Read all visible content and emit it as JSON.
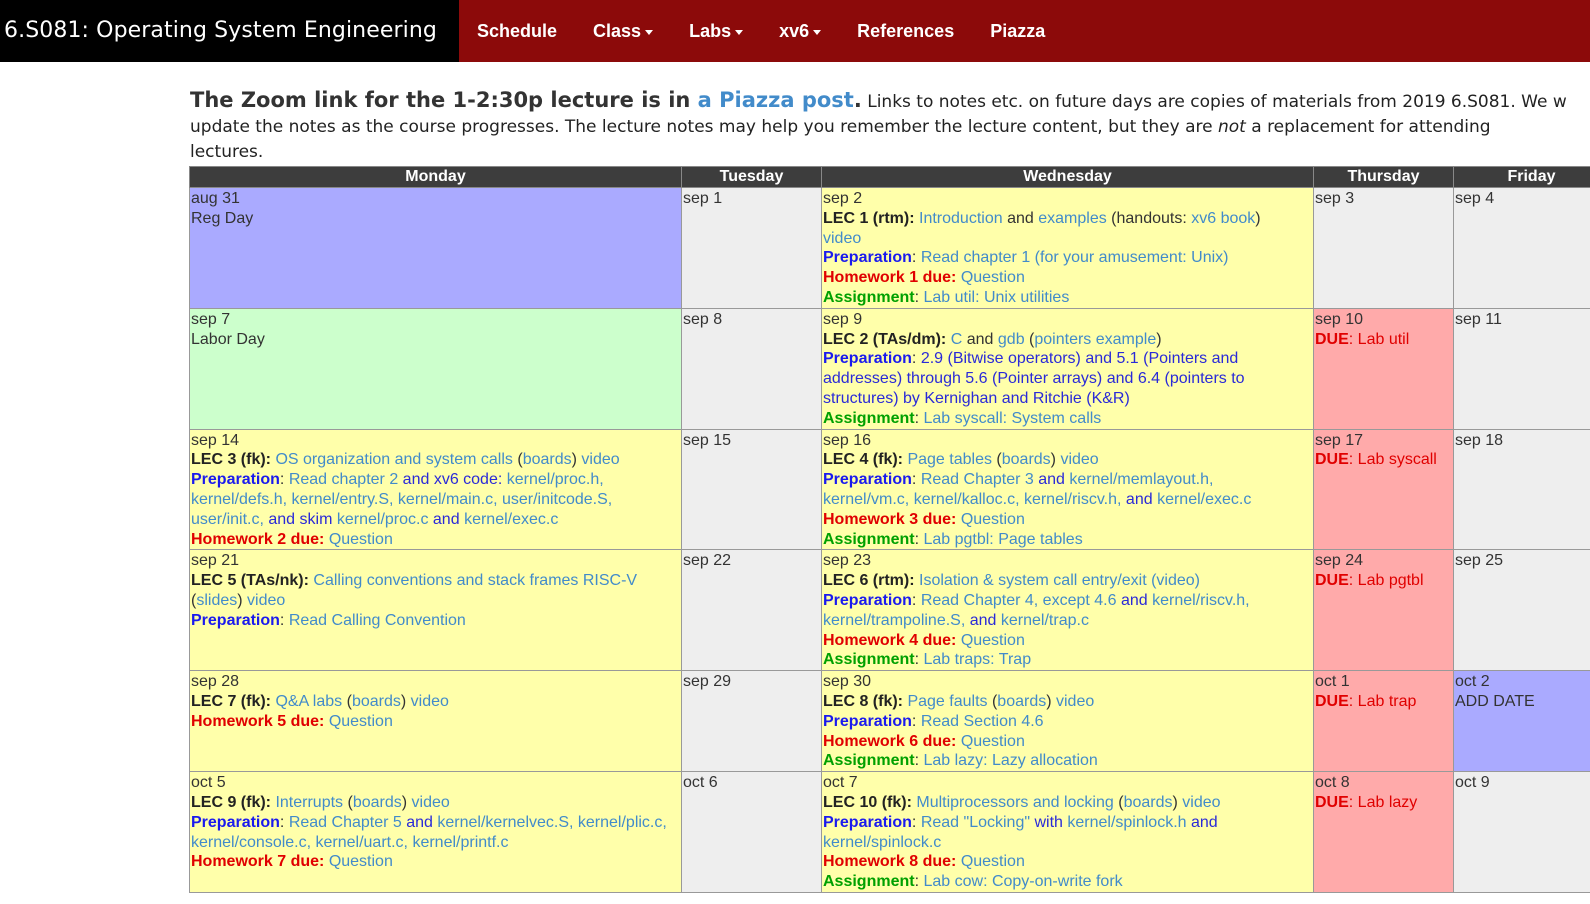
{
  "navbar": {
    "brand": "6.S081: Operating System Engineering",
    "items": [
      "Schedule",
      "Class",
      "Labs",
      "xv6",
      "References",
      "Piazza"
    ]
  },
  "intro": {
    "lead_prefix": "The Zoom link for the 1-2:30p lecture is in ",
    "lead_link": "a Piazza post",
    "lead_suffix": ".",
    "line1_rest": " Links to notes etc. on future days are copies of materials from 2019 6.S081. We w",
    "line2": "update the notes as the course progresses. The lecture notes may help you remember the lecture content, but they are ",
    "line2_em": "not",
    "line2_end": " a replacement for attending",
    "line3": "lectures."
  },
  "calendar": {
    "headers": [
      "Monday",
      "Tuesday",
      "Wednesday",
      "Thursday",
      "Friday"
    ],
    "rows": [
      {
        "mon": {
          "date": "aug 31",
          "note": "Reg Day"
        },
        "tue": {
          "date": "sep 1"
        },
        "wed": {
          "date": "sep 2",
          "lec": "LEC 1 (rtm):",
          "topic": "Introduction",
          "and": "and",
          "topic2": "examples",
          "handouts_pre": "(handouts:",
          "handouts_link": "xv6 book",
          "handouts_post": ")",
          "video": "video",
          "prep_label": "Preparation",
          "prep_text": "Read chapter 1 (for your amusement: Unix)",
          "hw_label": "Homework 1 due:",
          "hw_link": "Question",
          "asg_label": "Assignment",
          "asg_link": "Lab util: Unix utilities"
        },
        "thu": {
          "date": "sep 3"
        },
        "fri": {
          "date": "sep 4"
        }
      },
      {
        "mon": {
          "date": "sep 7",
          "note": "Labor Day"
        },
        "tue": {
          "date": "sep 8"
        },
        "wed": {
          "date": "sep 9",
          "lec": "LEC 2 (TAs/dm):",
          "topic": "C",
          "and": "and",
          "topic2": "gdb",
          "extra_pre": "(",
          "extra_link": "pointers example",
          "extra_post": ")",
          "prep_label": "Preparation",
          "prep_line1": "2.9 (Bitwise operators) and 5.1 (Pointers and",
          "prep_line2": "addresses) through 5.6 (Pointer arrays) and 6.4 (pointers to",
          "prep_line3": "structures) by Kernighan and Ritchie (K&R)",
          "asg_label": "Assignment",
          "asg_link": "Lab syscall: System calls"
        },
        "thu": {
          "date": "sep 10",
          "due_label": "DUE",
          "due_text": "Lab util"
        },
        "fri": {
          "date": "sep 11"
        }
      },
      {
        "mon": {
          "date": "sep 14",
          "lec": "LEC 3 (fk):",
          "topic": "OS organization and system calls",
          "boards": "boards",
          "video": "video",
          "prep_label": "Preparation",
          "prep_line1_a": "Read chapter 2",
          "prep_line1_b": "and xv6 code:",
          "prep_line1_c": "kernel/proc.h,",
          "prep_line2": "kernel/defs.h, kernel/entry.S, kernel/main.c, user/initcode.S,",
          "prep_line3_a": "user/init.c,",
          "prep_line3_b": "and skim",
          "prep_line3_c": "kernel/proc.c",
          "prep_line3_d": "and",
          "prep_line3_e": "kernel/exec.c",
          "hw_label": "Homework 2 due:",
          "hw_link": "Question"
        },
        "tue": {
          "date": "sep 15"
        },
        "wed": {
          "date": "sep 16",
          "lec": "LEC 4 (fk):",
          "topic": "Page tables",
          "boards": "boards",
          "video": "video",
          "prep_label": "Preparation",
          "prep_line1_a": "Read Chapter 3",
          "prep_line1_b": "and",
          "prep_line1_c": "kernel/memlayout.h,",
          "prep_line2_a": "kernel/vm.c, kernel/kalloc.c, kernel/riscv.h,",
          "prep_line2_b": "and",
          "prep_line2_c": "kernel/exec.c",
          "hw_label": "Homework 3 due:",
          "hw_link": "Question",
          "asg_label": "Assignment",
          "asg_link": "Lab pgtbl: Page tables"
        },
        "thu": {
          "date": "sep 17",
          "due_label": "DUE",
          "due_text": "Lab syscall"
        },
        "fri": {
          "date": "sep 18"
        }
      },
      {
        "mon": {
          "date": "sep 21",
          "lec": "LEC 5 (TAs/nk):",
          "topic": "Calling conventions and stack frames RISC-V",
          "slides": "slides",
          "video": "video",
          "prep_label": "Preparation",
          "prep_text": "Read Calling Convention"
        },
        "tue": {
          "date": "sep 22"
        },
        "wed": {
          "date": "sep 23",
          "lec": "LEC 6 (rtm):",
          "topic": "Isolation & system call entry/exit (video)",
          "prep_label": "Preparation",
          "prep_line1_a": "Read Chapter 4, except 4.6",
          "prep_line1_b": "and",
          "prep_line1_c": "kernel/riscv.h,",
          "prep_line2_a": "kernel/trampoline.S,",
          "prep_line2_b": "and",
          "prep_line2_c": "kernel/trap.c",
          "hw_label": "Homework 4 due:",
          "hw_link": "Question",
          "asg_label": "Assignment",
          "asg_link": "Lab traps: Trap"
        },
        "thu": {
          "date": "sep 24",
          "due_label": "DUE",
          "due_text": "Lab pgtbl"
        },
        "fri": {
          "date": "sep 25"
        }
      },
      {
        "mon": {
          "date": "sep 28",
          "lec": "LEC 7 (fk):",
          "topic": "Q&A labs",
          "boards": "boards",
          "video": "video",
          "hw_label": "Homework 5 due:",
          "hw_link": "Question"
        },
        "tue": {
          "date": "sep 29"
        },
        "wed": {
          "date": "sep 30",
          "lec": "LEC 8 (fk):",
          "topic": "Page faults",
          "boards": "boards",
          "video": "video",
          "prep_label": "Preparation",
          "prep_text": "Read Section 4.6",
          "hw_label": "Homework 6 due:",
          "hw_link": "Question",
          "asg_label": "Assignment",
          "asg_link": "Lab lazy: Lazy allocation"
        },
        "thu": {
          "date": "oct 1",
          "due_label": "DUE",
          "due_text": "Lab trap"
        },
        "fri": {
          "date": "oct 2",
          "note": "ADD DATE"
        }
      },
      {
        "mon": {
          "date": "oct 5",
          "lec": "LEC 9 (fk):",
          "topic": "Interrupts",
          "boards": "boards",
          "video": "video",
          "prep_label": "Preparation",
          "prep_line1_a": "Read Chapter 5",
          "prep_line1_b": "and",
          "prep_line1_c": "kernel/kernelvec.S, kernel/plic.c,",
          "prep_line2": "kernel/console.c, kernel/uart.c, kernel/printf.c",
          "hw_label": "Homework 7 due:",
          "hw_link": "Question"
        },
        "tue": {
          "date": "oct 6"
        },
        "wed": {
          "date": "oct 7",
          "lec": "LEC 10 (fk):",
          "topic": "Multiprocessors and locking",
          "boards": "boards",
          "video": "video",
          "prep_label": "Preparation",
          "prep_line1_a": "Read \"Locking\"",
          "prep_line1_b": "with",
          "prep_line1_c": "kernel/spinlock.h",
          "prep_line1_d": "and",
          "prep_line2": "kernel/spinlock.c",
          "hw_label": "Homework 8 due:",
          "hw_link": "Question",
          "asg_label": "Assignment",
          "asg_link": "Lab cow: Copy-on-write fork"
        },
        "thu": {
          "date": "oct 8",
          "due_label": "DUE",
          "due_text": "Lab lazy"
        },
        "fri": {
          "date": "oct 9"
        }
      }
    ]
  }
}
